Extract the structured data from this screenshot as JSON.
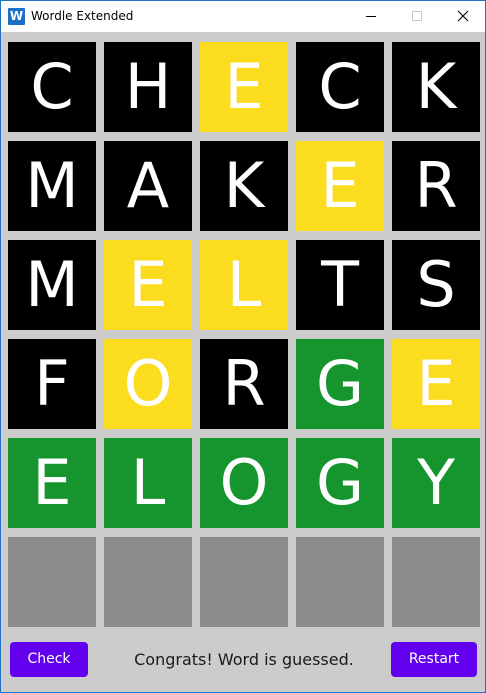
{
  "window": {
    "title": "Wordle Extended",
    "icon_letter": "W",
    "accent_color": "#1b6fc5"
  },
  "board": {
    "colors": {
      "absent": "#000000",
      "present": "#fcdc1f",
      "correct": "#16942e",
      "empty": "#8c8c8c",
      "background": "#cccccc"
    },
    "rows": [
      {
        "letters": [
          "C",
          "H",
          "E",
          "C",
          "K"
        ],
        "states": [
          "absent",
          "absent",
          "present",
          "absent",
          "absent"
        ]
      },
      {
        "letters": [
          "M",
          "A",
          "K",
          "E",
          "R"
        ],
        "states": [
          "absent",
          "absent",
          "absent",
          "present",
          "absent"
        ]
      },
      {
        "letters": [
          "M",
          "E",
          "L",
          "T",
          "S"
        ],
        "states": [
          "absent",
          "present",
          "present",
          "absent",
          "absent"
        ]
      },
      {
        "letters": [
          "F",
          "O",
          "R",
          "G",
          "E"
        ],
        "states": [
          "absent",
          "present",
          "absent",
          "correct",
          "present"
        ]
      },
      {
        "letters": [
          "E",
          "L",
          "O",
          "G",
          "Y"
        ],
        "states": [
          "correct",
          "correct",
          "correct",
          "correct",
          "correct"
        ]
      },
      {
        "letters": [
          "",
          "",
          "",
          "",
          ""
        ],
        "states": [
          "empty",
          "empty",
          "empty",
          "empty",
          "empty"
        ]
      }
    ]
  },
  "footer": {
    "check_label": "Check",
    "status_text": "Congrats! Word is guessed.",
    "restart_label": "Restart",
    "button_color": "#6200ee"
  }
}
